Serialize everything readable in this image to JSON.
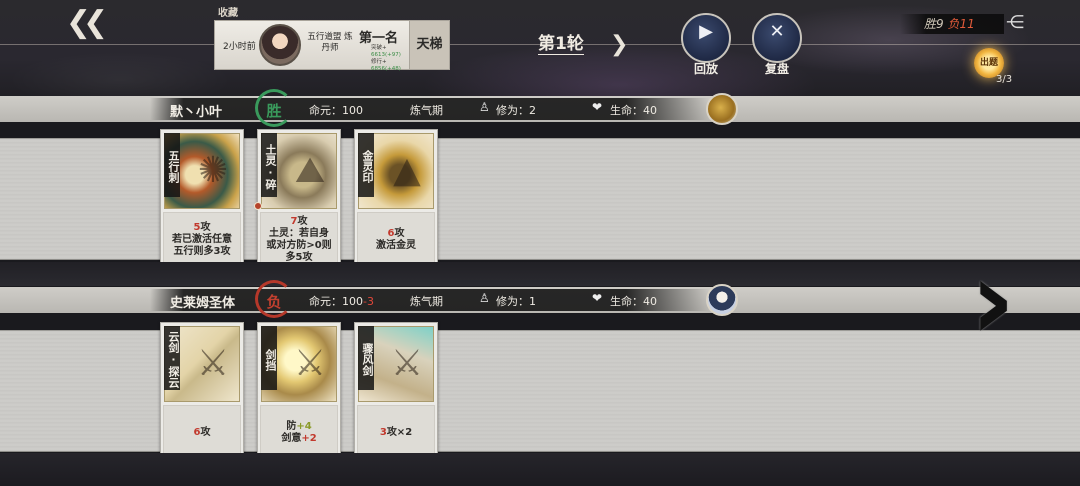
{
  "header": {
    "back_icon": "double-arrow-left-icon",
    "favorites_label": "收藏",
    "rank_card": {
      "time": "2小时前",
      "school": "五行道盟 炼丹师",
      "rank": "第一名",
      "stats": [
        "突破+",
        "6613(+97)",
        "修行+",
        "6856(+48)"
      ],
      "mode": "天梯"
    },
    "round_label": "第1轮",
    "replay_label": "回放",
    "review_label": "复盘",
    "win_label": "胜9",
    "lose_label": "负11",
    "lantern_label": "出题",
    "lantern_count": "3/3",
    "accent_win": "#3a9a5c",
    "accent_lose": "#c2402f"
  },
  "players": [
    {
      "name": "默丶小叶",
      "result": "胜",
      "life_label": "命元：",
      "life": "100",
      "life_delta": "",
      "realm": "炼气期",
      "cultivation_label": "修为：",
      "cultivation": "2",
      "health_label": "生命：",
      "health": "40",
      "cards": [
        {
          "name": "五行刺",
          "desc_red": "5",
          "desc_main": "攻",
          "desc_extra": "若已激活任意\n五行则多3攻"
        },
        {
          "name": "土灵·碎",
          "desc_red": "7",
          "desc_main": "攻",
          "desc_extra": "土灵：若自身\n或对方防>0则\n多5攻"
        },
        {
          "name": "金灵印",
          "desc_red": "6",
          "desc_main": "攻",
          "desc_extra": "激活金灵"
        }
      ]
    },
    {
      "name": "史莱姆圣体",
      "result": "负",
      "life_label": "命元：",
      "life": "100",
      "life_delta": "-3",
      "realm": "炼气期",
      "cultivation_label": "修为：",
      "cultivation": "1",
      "health_label": "生命：",
      "health": "40",
      "cards": [
        {
          "name": "云剑·探云",
          "desc_red": "6",
          "desc_main": "攻",
          "desc_extra": ""
        },
        {
          "name": "剑挡",
          "desc_main": "防",
          "desc_green": "+4",
          "desc_extra": "剑意",
          "desc_extra_red": "+2"
        },
        {
          "name": "骤风剑",
          "desc_red": "3",
          "desc_main": "攻×2",
          "desc_extra": ""
        }
      ]
    }
  ]
}
